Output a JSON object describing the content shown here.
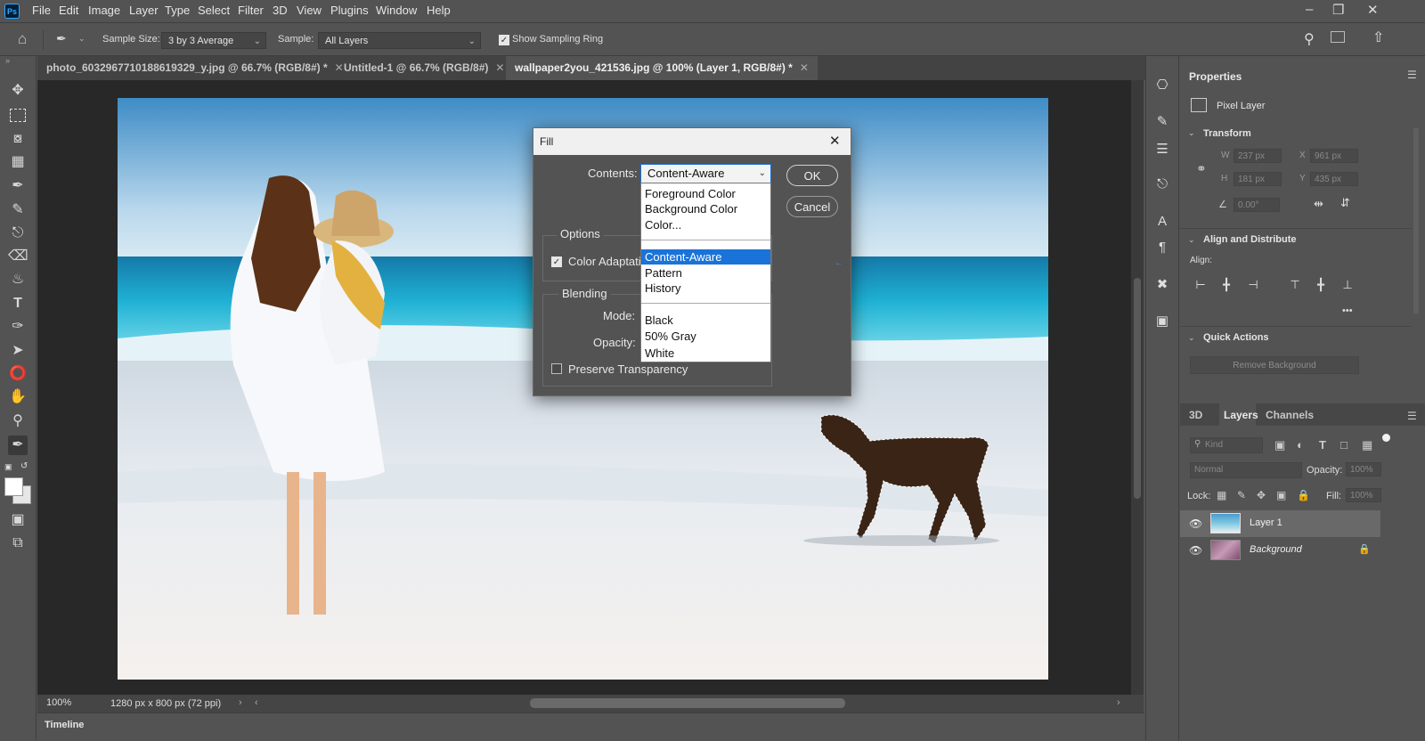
{
  "menubar": {
    "logo": "Ps",
    "items": [
      "File",
      "Edit",
      "Image",
      "Layer",
      "Type",
      "Select",
      "Filter",
      "3D",
      "View",
      "Plugins",
      "Window",
      "Help"
    ]
  },
  "options": {
    "sample_size_label": "Sample Size:",
    "sample_size_value": "3 by 3 Average",
    "sample_label": "Sample:",
    "sample_value": "All Layers",
    "show_ring_label": "Show Sampling Ring"
  },
  "tabs": [
    {
      "label": "photo_6032967710188619329_y.jpg @ 66.7% (RGB/8#) *",
      "active": false
    },
    {
      "label": "Untitled-1 @ 66.7% (RGB/8#)",
      "active": false
    },
    {
      "label": "wallpaper2you_421536.jpg @ 100% (Layer 1, RGB/8#) *",
      "active": true
    }
  ],
  "status": {
    "zoom": "100%",
    "doc_size": "1280 px x 800 px (72 ppi)",
    "timeline": "Timeline"
  },
  "properties": {
    "tab": "Properties",
    "pixel_layer": "Pixel Layer",
    "transform_title": "Transform",
    "w_label": "W",
    "w_value": "237 px",
    "x_label": "X",
    "x_value": "961 px",
    "h_label": "H",
    "h_value": "181 px",
    "y_label": "Y",
    "y_value": "435 px",
    "angle_value": "0.00°",
    "align_title": "Align and Distribute",
    "align_label": "Align:",
    "more": "•••",
    "quick_actions_title": "Quick Actions",
    "remove_bg": "Remove Background"
  },
  "layers_panel": {
    "tabs": [
      "3D",
      "Layers",
      "Channels"
    ],
    "kind_placeholder": "Kind",
    "blend_mode": "Normal",
    "opacity_label": "Opacity:",
    "opacity_value": "100%",
    "lock_label": "Lock:",
    "fill_label": "Fill:",
    "fill_value": "100%",
    "layers": [
      {
        "name": "Layer 1",
        "selected": true
      },
      {
        "name": "Background",
        "selected": false
      }
    ]
  },
  "fill_dialog": {
    "title": "Fill",
    "contents_label": "Contents:",
    "contents_value": "Content-Aware",
    "ok": "OK",
    "cancel": "Cancel",
    "options_title": "Options",
    "color_adaptation": "Color Adaptatio",
    "blending_title": "Blending",
    "mode_label": "Mode:",
    "opacity_label": "Opacity:",
    "preserve_transparency": "Preserve Transparency",
    "dropdown_options": [
      "Foreground Color",
      "Background Color",
      "Color...",
      "Content-Aware",
      "Pattern",
      "History",
      "Black",
      "50% Gray",
      "White"
    ],
    "selected_option": "Content-Aware"
  },
  "colors": {
    "ui_bg": "#535353",
    "canvas_bg": "#282828",
    "selection_blue": "#1a73d8"
  }
}
